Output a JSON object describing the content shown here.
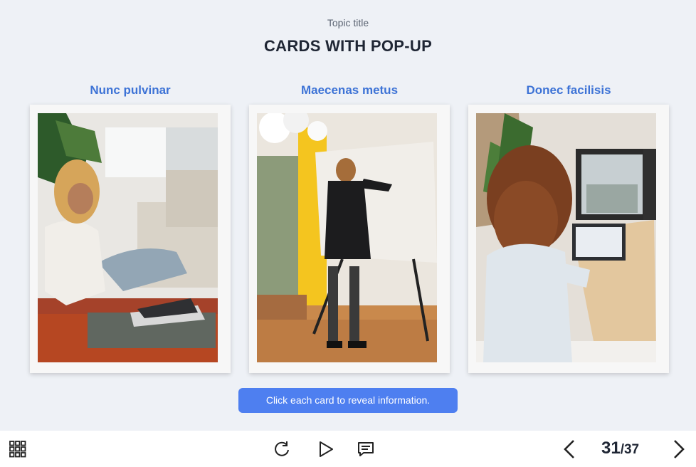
{
  "header": {
    "topic": "Topic title",
    "title": "CARDS WITH POP-UP"
  },
  "cards": [
    {
      "title": "Nunc pulvinar",
      "image": "woman-sitting-on-floor-with-laptop"
    },
    {
      "title": "Maecenas metus",
      "image": "woman-writing-on-whiteboard"
    },
    {
      "title": "Donec facilisis",
      "image": "woman-working-at-standing-desk"
    }
  ],
  "hint": "Click each card to reveal information.",
  "footer": {
    "icons": {
      "menu": "grid-menu-icon",
      "replay": "replay-icon",
      "play": "play-icon",
      "comments": "comment-icon",
      "prev": "chevron-left-icon",
      "next": "chevron-right-icon"
    },
    "page_current": "31",
    "page_total": "/37"
  },
  "colors": {
    "accent": "#4e7ff0",
    "card_title": "#3d73d6",
    "background": "#eef1f6"
  }
}
